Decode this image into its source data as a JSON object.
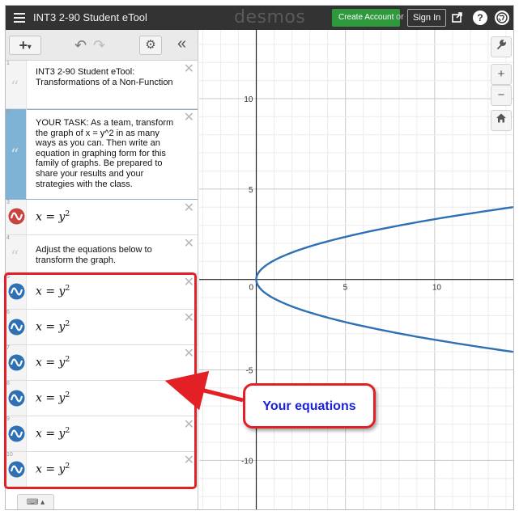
{
  "header": {
    "title": "INT3 2-90 Student eTool",
    "brand": "desmos",
    "create_account": "Create Account",
    "or": "or",
    "sign_in": "Sign In",
    "icons": [
      "share-icon",
      "help-icon",
      "language-icon"
    ]
  },
  "toolbar": {
    "add": "+",
    "undo_icon": "undo-icon",
    "redo_icon": "redo-icon",
    "settings_icon": "gear-icon",
    "collapse": "«"
  },
  "expressions": [
    {
      "index": "1",
      "type": "note",
      "text": "INT3 2-90 Student eTool: Transformations of a Non-Function"
    },
    {
      "index": "2",
      "type": "note",
      "text": "YOUR TASK: As a team, transform the graph of x = y^2 in as many ways as you can. Then write an equation in graphing form for this family of graphs. Be prepared to share your results and your strategies with the class."
    },
    {
      "index": "3",
      "type": "expression",
      "lhs": "x = y",
      "exp": "2",
      "color": "#c74440"
    },
    {
      "index": "4",
      "type": "note",
      "text": "Adjust the equations below to transform the graph."
    },
    {
      "index": "5",
      "type": "expression",
      "lhs": "x = y",
      "exp": "2",
      "color": "#2d70b3"
    },
    {
      "index": "6",
      "type": "expression",
      "lhs": "x = y",
      "exp": "2",
      "color": "#2d70b3"
    },
    {
      "index": "7",
      "type": "expression",
      "lhs": "x = y",
      "exp": "2",
      "color": "#2d70b3"
    },
    {
      "index": "8",
      "type": "expression",
      "lhs": "x = y",
      "exp": "2",
      "color": "#2d70b3"
    },
    {
      "index": "9",
      "type": "expression",
      "lhs": "x = y",
      "exp": "2",
      "color": "#2d70b3"
    },
    {
      "index": "10",
      "type": "expression",
      "lhs": "x = y",
      "exp": "2",
      "color": "#2d70b3"
    }
  ],
  "graph_controls": {
    "wrench": "wrench-icon",
    "zoom_in": "+",
    "zoom_out": "−",
    "home": "home-icon"
  },
  "graph": {
    "x_ticks": [
      "0",
      "5",
      "10"
    ],
    "y_ticks": [
      "10",
      "5",
      "-5",
      "-10"
    ],
    "curve_color": "#2d70b3",
    "x_range": [
      -3.2,
      14.5
    ],
    "y_range": [
      -12.8,
      13.8
    ]
  },
  "annotation": {
    "label": "Your equations",
    "color": "#e22026",
    "text_color": "#1a1fd8"
  },
  "keyboard_toggle": "keyboard-icon"
}
